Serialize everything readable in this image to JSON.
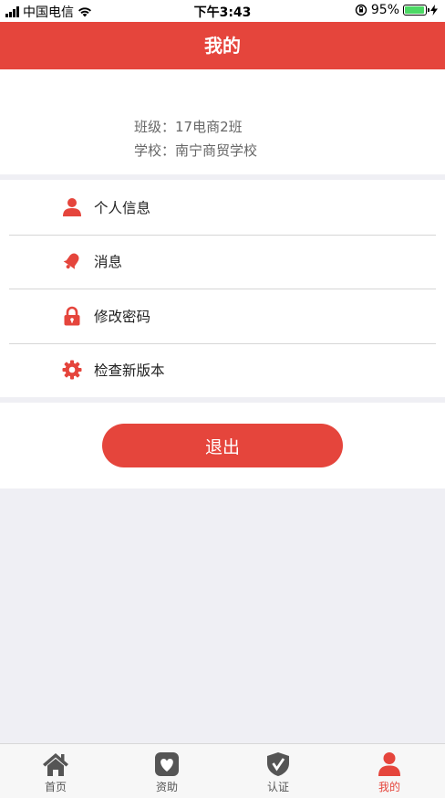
{
  "status_bar": {
    "carrier": "中国电信",
    "time": "下午3:43",
    "battery_percent": "95%",
    "battery_level": 0.95
  },
  "nav": {
    "title": "我的"
  },
  "profile": {
    "class_line": "班级：17电商2班",
    "school_line": "学校：南宁商贸学校"
  },
  "menu": {
    "items": [
      {
        "label": "个人信息",
        "icon": "person-icon"
      },
      {
        "label": "消息",
        "icon": "bell-icon"
      },
      {
        "label": "修改密码",
        "icon": "lock-icon"
      },
      {
        "label": "检查新版本",
        "icon": "gear-icon"
      }
    ]
  },
  "logout": {
    "label": "退出"
  },
  "tabs": [
    {
      "label": "首页",
      "icon": "home-icon"
    },
    {
      "label": "资助",
      "icon": "heart-icon"
    },
    {
      "label": "认证",
      "icon": "shield-check-icon"
    },
    {
      "label": "我的",
      "icon": "person-icon",
      "active": true
    }
  ],
  "colors": {
    "accent": "#e5453c",
    "background": "#efeff4",
    "inactive_icon": "#555555"
  }
}
